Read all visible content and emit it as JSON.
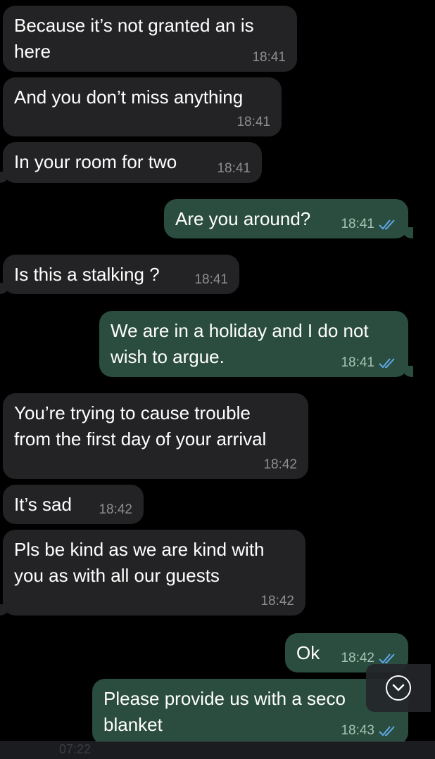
{
  "messages": [
    {
      "direction": "in",
      "text": "Because it’s not granted an is\nhere",
      "time": "18:41"
    },
    {
      "direction": "in",
      "text": "And you don’t miss anything",
      "time": "18:41"
    },
    {
      "direction": "in",
      "text": "In your room for two",
      "time": "18:41"
    },
    {
      "direction": "out",
      "text": "Are you around?",
      "time": "18:41",
      "status": "read"
    },
    {
      "direction": "in",
      "text": "Is this a stalking ?",
      "time": "18:41"
    },
    {
      "direction": "out",
      "text": "We are in a holiday and I do not\nwish to argue.",
      "time": "18:41",
      "status": "read"
    },
    {
      "direction": "in",
      "text": "You’re trying to cause trouble\nfrom the first day of your arrival",
      "time": "18:42"
    },
    {
      "direction": "in",
      "text": "It’s sad",
      "time": "18:42"
    },
    {
      "direction": "in",
      "text": "Pls be kind as we are kind with\nyou as with all our guests",
      "time": "18:42"
    },
    {
      "direction": "out",
      "text": "Ok",
      "time": "18:42",
      "status": "read"
    },
    {
      "direction": "out",
      "text": "Please provide us with a seco\nblanket",
      "time": "18:43",
      "status": "read"
    }
  ],
  "scroll_button": {
    "icon": "chevron-down-icon"
  },
  "bottom_ghost_text": "07:22",
  "colors": {
    "background": "#000000",
    "incoming_bubble": "#232325",
    "outgoing_bubble": "#2b4d3f",
    "read_ticks": "#5fa8e8"
  }
}
